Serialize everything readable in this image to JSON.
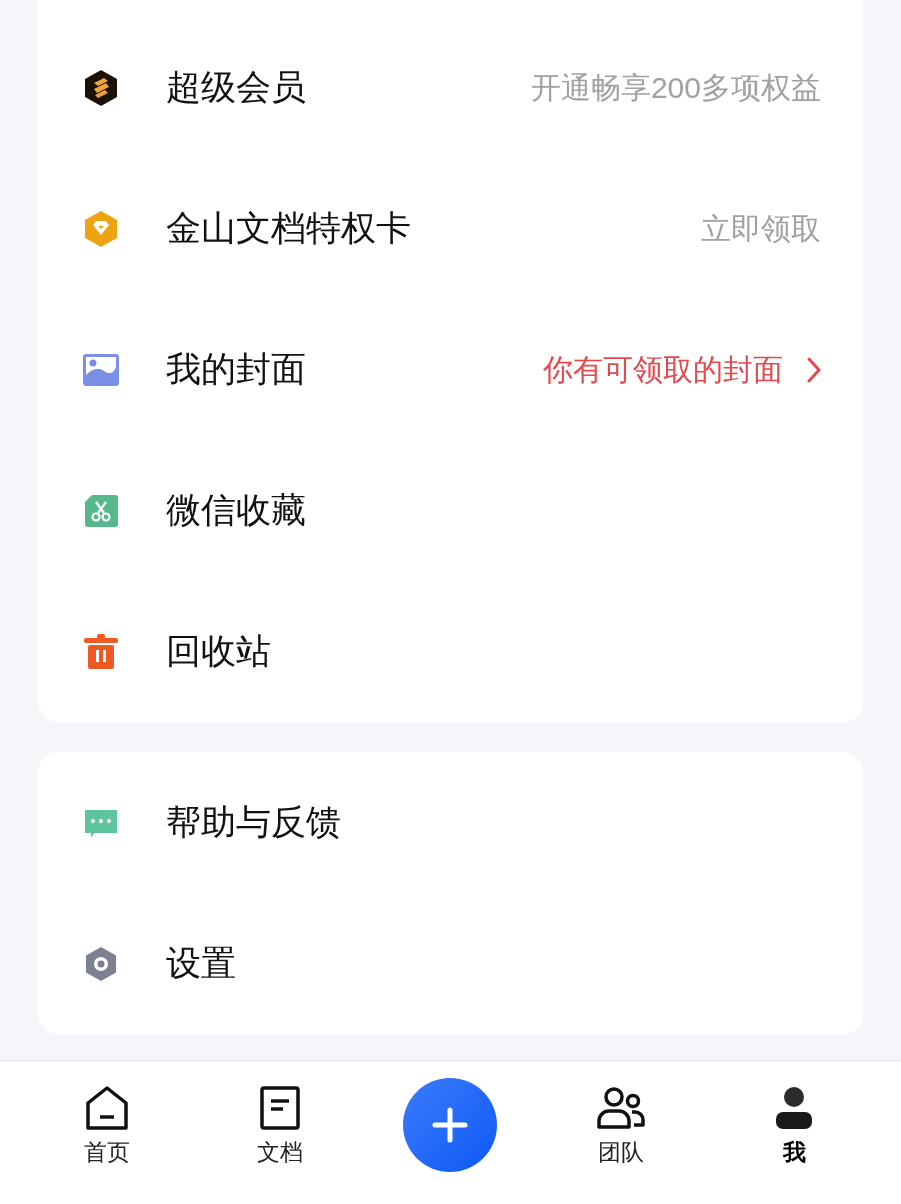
{
  "groups": [
    {
      "items": [
        {
          "kind": "vip",
          "label": "超级会员",
          "value": "开通畅享200多项权益",
          "highlighted": false
        },
        {
          "kind": "card",
          "label": "金山文档特权卡",
          "value": "立即领取",
          "highlighted": false
        },
        {
          "kind": "image",
          "label": "我的封面",
          "value": "你有可领取的封面",
          "highlighted": true
        },
        {
          "kind": "wechat",
          "label": "微信收藏"
        },
        {
          "kind": "trash",
          "label": "回收站"
        }
      ]
    },
    {
      "items": [
        {
          "kind": "help",
          "label": "帮助与反馈"
        },
        {
          "kind": "settings",
          "label": "设置"
        }
      ]
    }
  ],
  "tabs": [
    {
      "kind": "home",
      "label": "首页",
      "selected": false
    },
    {
      "kind": "docs",
      "label": "文档",
      "selected": false
    },
    {
      "kind": "add"
    },
    {
      "kind": "team",
      "label": "团队",
      "selected": false
    },
    {
      "kind": "me",
      "label": "我",
      "selected": true
    }
  ]
}
